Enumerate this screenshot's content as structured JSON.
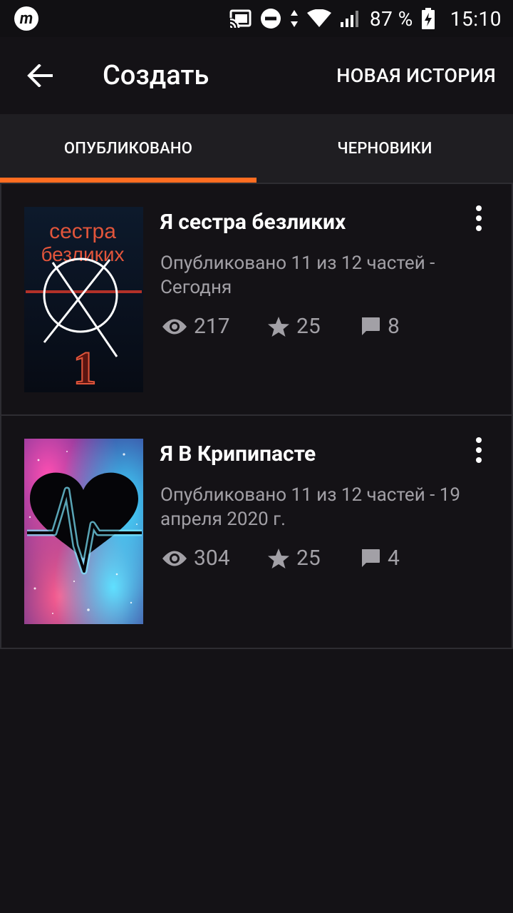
{
  "status_bar": {
    "app_icon_letter": "m",
    "battery": "87 %",
    "time": "15:10",
    "icons": [
      "cast-icon",
      "do-not-disturb-icon",
      "data-arrows-icon",
      "wifi-icon",
      "signal-icon",
      "battery-charging-icon"
    ]
  },
  "app_bar": {
    "title": "Создать",
    "new_story_label": "НОВАЯ ИСТОРИЯ",
    "back_icon": "arrow-left-icon"
  },
  "tabs": [
    {
      "label": "ОПУБЛИКОВАНО",
      "active": true
    },
    {
      "label": "ЧЕРНОВИКИ",
      "active": false
    }
  ],
  "stories": [
    {
      "title": "Я сестра безликих",
      "meta": "Опубликовано 11 из 12 частей - Сегодня",
      "views": "217",
      "votes": "25",
      "comments": "8",
      "cover_text": [
        "сестра",
        "безликих",
        "1"
      ]
    },
    {
      "title": "Я В Крипипасте",
      "meta": "Опубликовано 11 из 12 частей - 19 апреля 2020 г.",
      "views": "304",
      "votes": "25",
      "comments": "4"
    }
  ],
  "colors": {
    "accent": "#ff6d21",
    "background": "#141216",
    "tab_bar": "#1f1e22",
    "meta_text": "#a2a0a6"
  }
}
